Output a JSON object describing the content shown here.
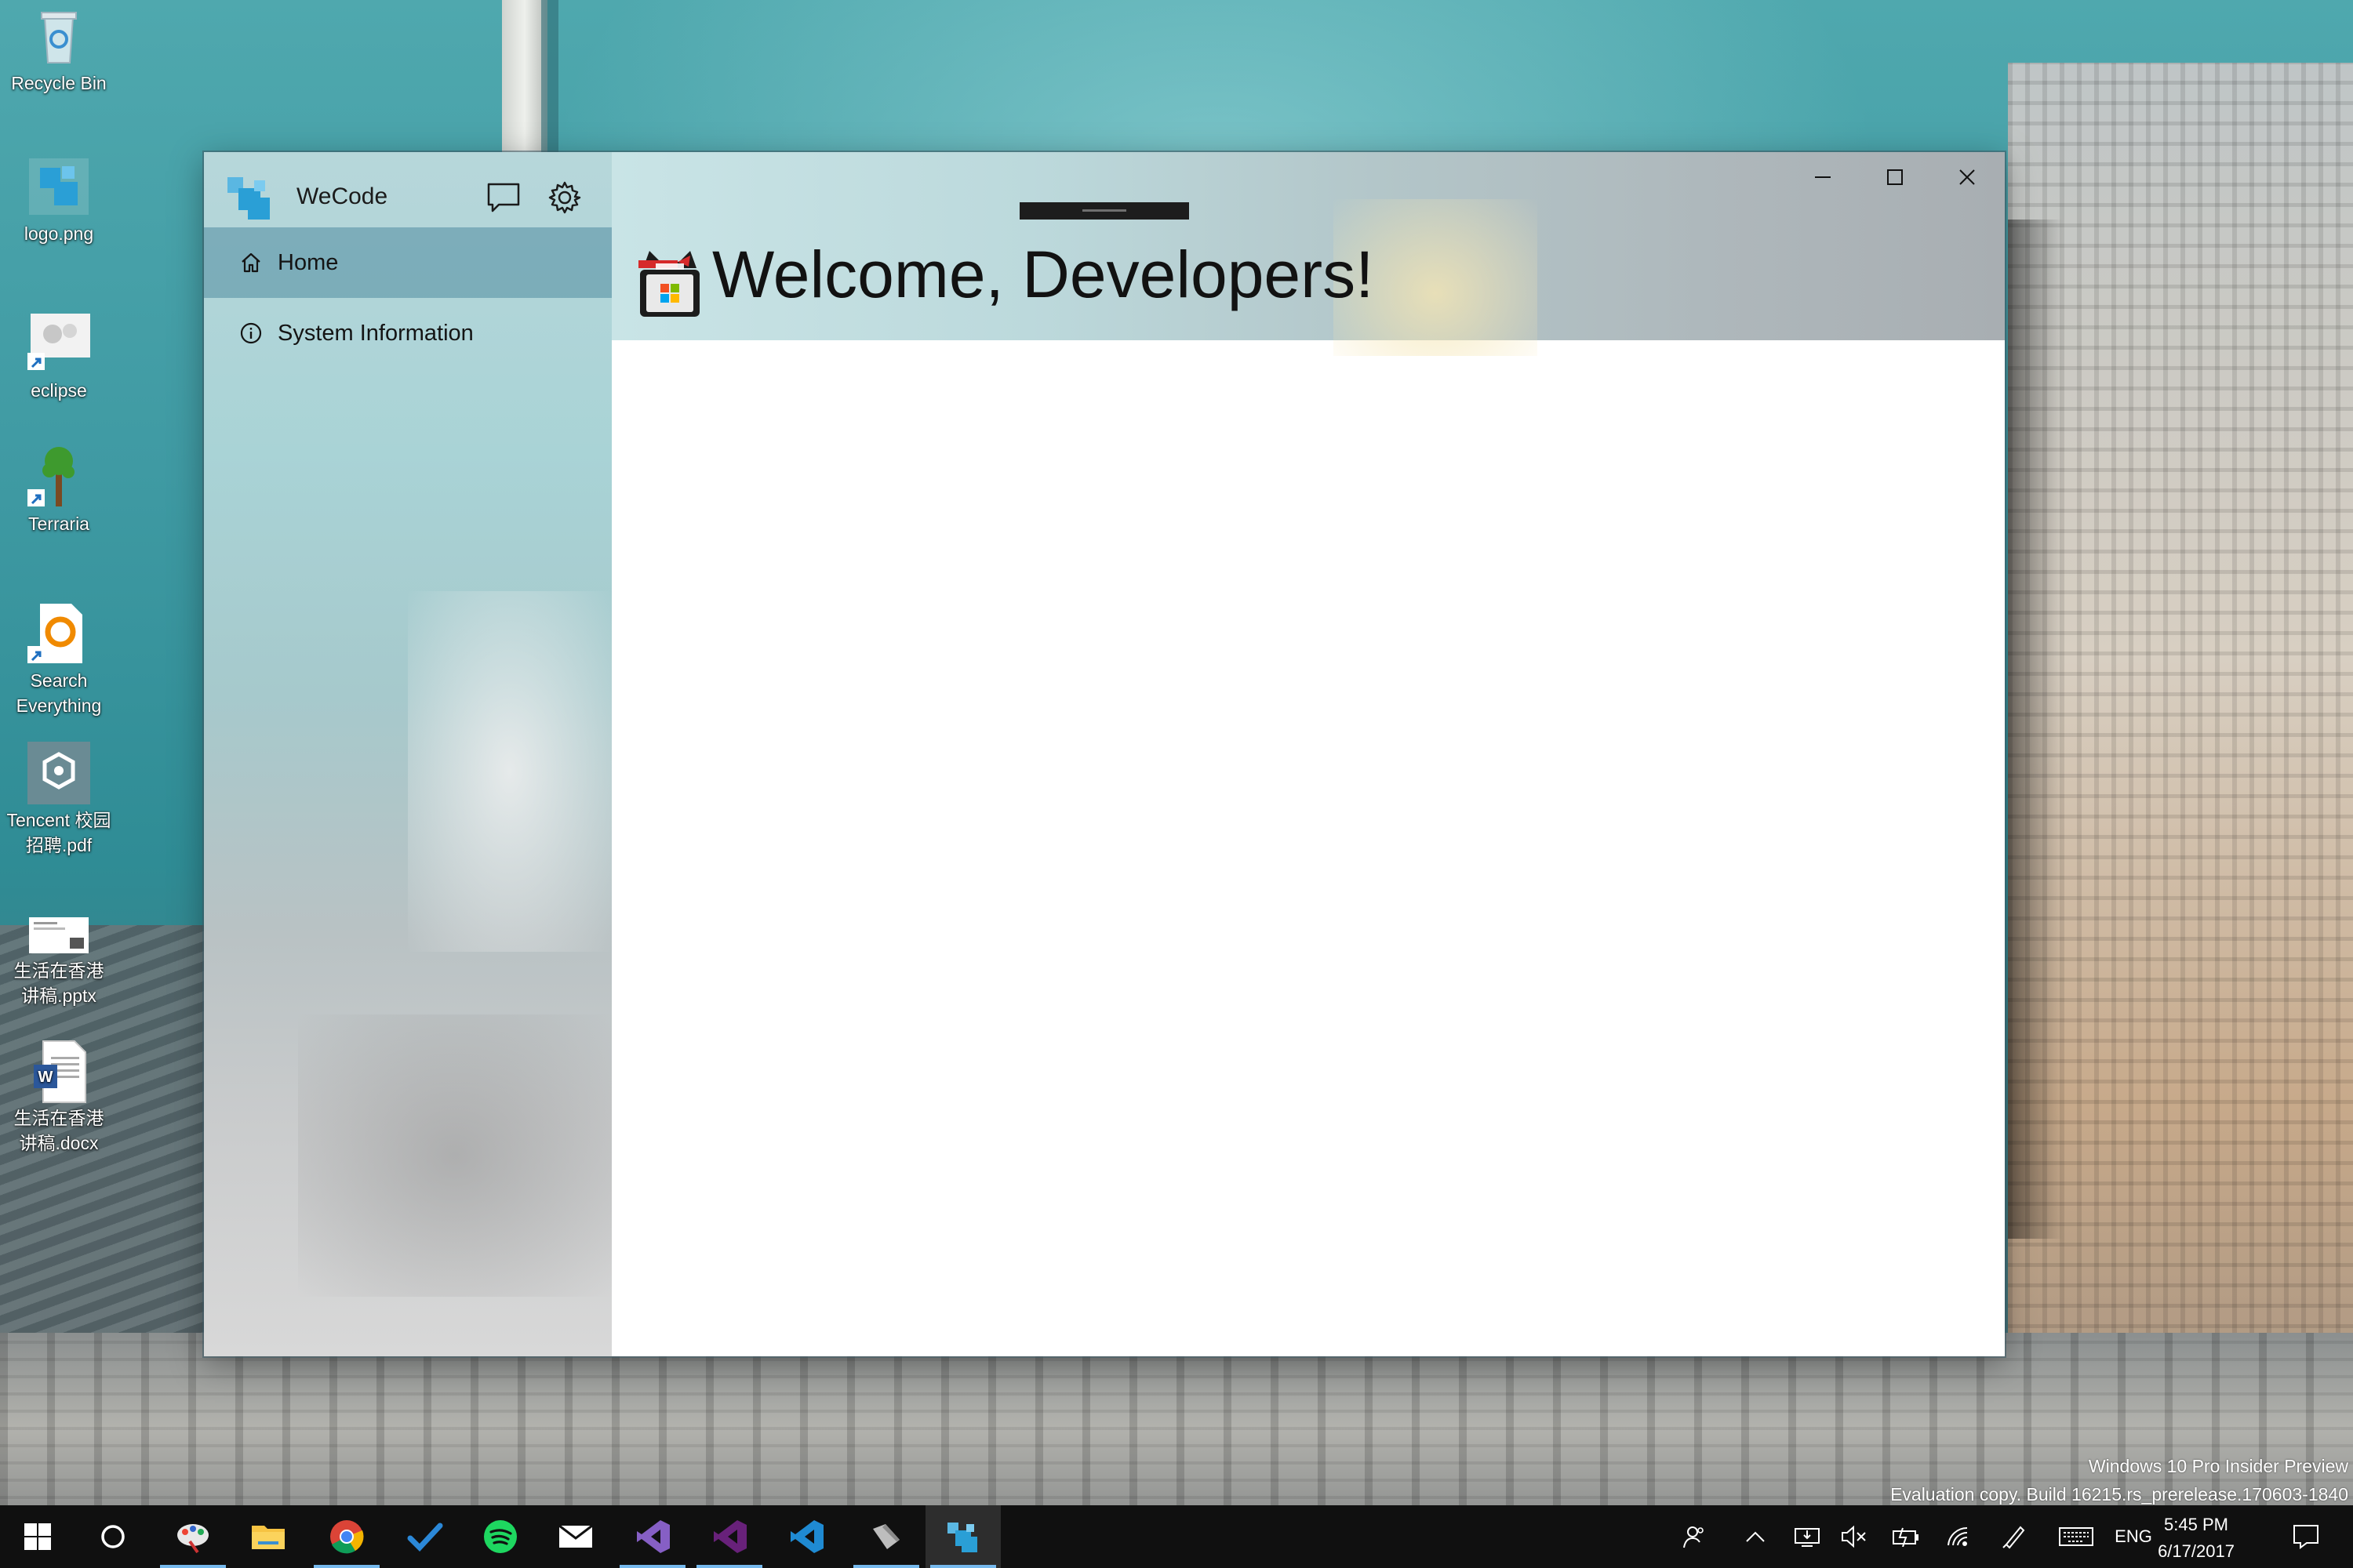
{
  "desktop": {
    "icons": [
      {
        "label": "Recycle Bin"
      },
      {
        "label": "logo.png"
      },
      {
        "label": "eclipse"
      },
      {
        "label": "Terraria"
      },
      {
        "label": "Search\nEverything"
      },
      {
        "label": "Tencent 校园\n招聘.pdf"
      },
      {
        "label": "生活在香港\n讲稿.pptx"
      },
      {
        "label": "生活在香港\n讲稿.docx"
      }
    ],
    "watermark": {
      "line1": "Windows 10 Pro Insider Preview",
      "line2": "Evaluation copy. Build 16215.rs_prerelease.170603-1840"
    }
  },
  "app": {
    "name": "WeCode",
    "feedback_icon": "chat-bubble-icon",
    "settings_icon": "gear-icon",
    "nav": [
      {
        "label": "Home",
        "icon": "home-icon",
        "selected": true
      },
      {
        "label": "System Information",
        "icon": "info-icon",
        "selected": false
      }
    ],
    "page_title": "Welcome, Developers!",
    "caption_buttons": [
      "minimize",
      "maximize",
      "close"
    ],
    "accent": "#2a9fd6"
  },
  "taskbar": {
    "apps": [
      "start",
      "cortana",
      "paint-app",
      "file-explorer",
      "chrome",
      "todo",
      "spotify",
      "mail",
      "visual-studio",
      "visual-studio-preview",
      "vs-code",
      "app-installer",
      "wecode"
    ],
    "language": "ENG",
    "time": "5:45 PM",
    "date": "6/17/2017"
  }
}
